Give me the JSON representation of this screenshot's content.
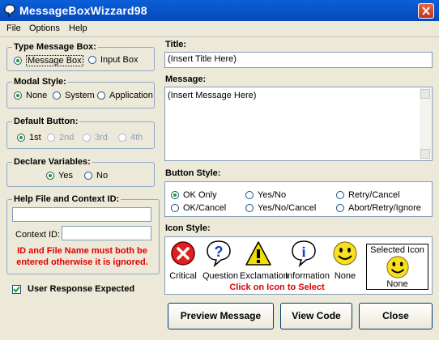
{
  "window": {
    "title": "MessageBoxWizzard98"
  },
  "menu": [
    {
      "label": "File"
    },
    {
      "label": "Options"
    },
    {
      "label": "Help"
    }
  ],
  "type_box": {
    "legend": "Type Message Box:",
    "options": [
      "Message Box",
      "Input Box"
    ],
    "selected": 0
  },
  "modal_style": {
    "legend": "Modal Style:",
    "options": [
      "None",
      "System",
      "Application"
    ],
    "selected": 0
  },
  "default_button": {
    "legend": "Default Button:",
    "options": [
      "1st",
      "2nd",
      "3rd",
      "4th"
    ],
    "selected": 0
  },
  "declare_vars": {
    "legend": "Declare Variables:",
    "options": [
      "Yes",
      "No"
    ],
    "selected": 0
  },
  "help": {
    "legend": "Help File and Context ID:",
    "file_value": "",
    "context_label": "Context ID:",
    "context_value": "",
    "warning": "ID and File Name must both be entered otherwise it is ignored."
  },
  "user_response": {
    "label": "User Response Expected",
    "checked": true
  },
  "title_field": {
    "label": "Title:",
    "value": "(Insert Title Here)"
  },
  "message_field": {
    "label": "Message:",
    "value": "(Insert Message Here)"
  },
  "button_style": {
    "label": "Button Style:",
    "options": [
      "OK Only",
      "Yes/No",
      "Retry/Cancel",
      "OK/Cancel",
      "Yes/No/Cancel",
      "Abort/Retry/Ignore"
    ],
    "selected": 0
  },
  "icon_style": {
    "label": "Icon Style:",
    "icons": [
      {
        "name": "critical-icon",
        "caption": "Critical",
        "color": "#e02020"
      },
      {
        "name": "question-icon",
        "caption": "Question",
        "color": "#1a3cc8"
      },
      {
        "name": "exclamation-icon",
        "caption": "Exclamation",
        "color": "#f0e000"
      },
      {
        "name": "information-icon",
        "caption": "Information",
        "color": "#1a3cc8"
      },
      {
        "name": "smiley-icon",
        "caption": "None",
        "color": "#f8e020"
      }
    ],
    "hint": "Click on Icon to Select",
    "selected_title": "Selected Icon",
    "selected_caption": "None"
  },
  "actions": {
    "preview": "Preview Message",
    "view_code": "View Code",
    "close": "Close"
  }
}
